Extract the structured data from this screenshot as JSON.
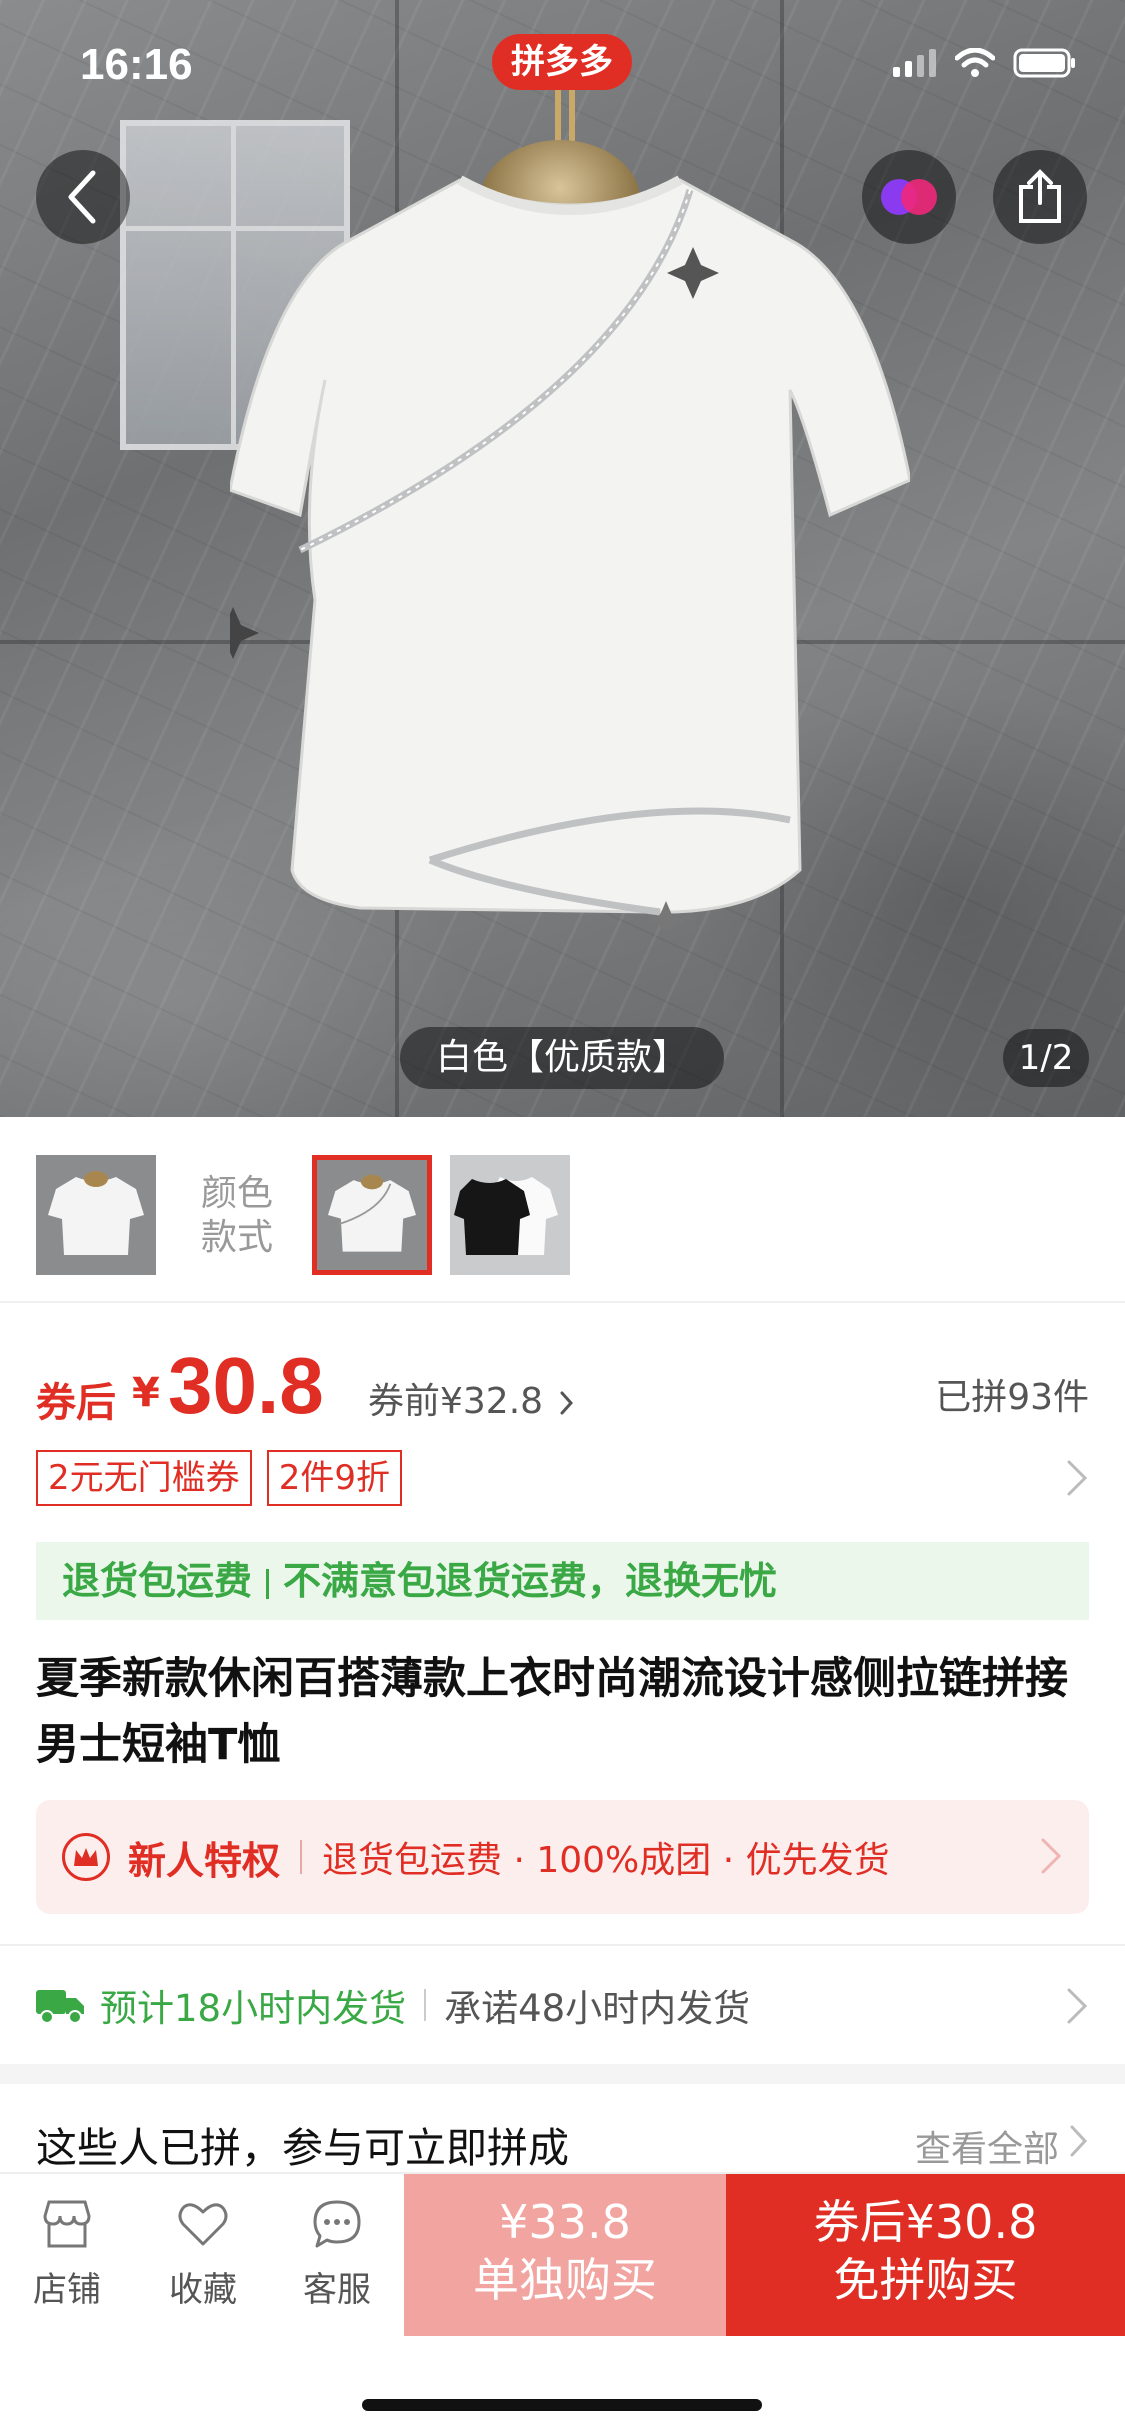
{
  "status_bar": {
    "time": "16:16",
    "brand": "拼多多"
  },
  "hero": {
    "variant_caption": "白色【优质款】",
    "page_indicator": "1/2"
  },
  "thumbnails": {
    "label": "颜色\n款式"
  },
  "price": {
    "prefix": "券后",
    "currency": "¥",
    "value": "30.8",
    "before": "券前¥32.8",
    "sold": "已拼93件"
  },
  "coupons": [
    "2元无门槛券",
    "2件9折"
  ],
  "return_banner": {
    "left": "退货包运费",
    "right": "不满意包退货运费，退换无忧"
  },
  "product_title": "夏季新款休闲百搭薄款上衣时尚潮流设计感侧拉链拼接男士短袖T恤",
  "new_user": {
    "title": "新人特权",
    "desc": "退货包运费 · 100%成团 · 优先发货"
  },
  "shipping": {
    "main": "预计18小时内发货",
    "promise": "承诺48小时内发货"
  },
  "group": {
    "title": "这些人已拼，参与可立即拼成",
    "view_all": "查看全部"
  },
  "bottom_bar": {
    "store": "店铺",
    "favorite": "收藏",
    "service": "客服",
    "solo_price": "¥33.8",
    "solo_label": "单独购买",
    "group_price": "券后¥30.8",
    "group_label": "免拼购买"
  },
  "colors": {
    "accent": "#e02e24",
    "green": "#39a845"
  }
}
